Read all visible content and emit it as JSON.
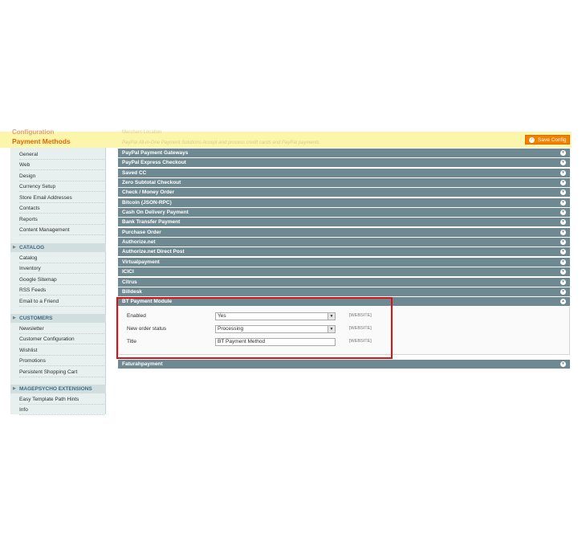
{
  "header": {
    "section_label": "Configuration",
    "page_title": "Payment Methods",
    "band_text_1": "Merchant Location",
    "band_text_2": "PayPal All-in-One Payment Solutions  Accept and process credit cards and PayPal payments",
    "save_button": "Save Config"
  },
  "sidebar": {
    "general_items": [
      "General",
      "Web",
      "Design",
      "Currency Setup",
      "Store Email Addresses",
      "Contacts",
      "Reports",
      "Content Management"
    ],
    "catalog_header": "CATALOG",
    "catalog_items": [
      "Catalog",
      "Inventory",
      "Google Sitemap",
      "RSS Feeds",
      "Email to a Friend"
    ],
    "customers_header": "CUSTOMERS",
    "customers_items": [
      "Newsletter",
      "Customer Configuration",
      "Wishlist",
      "Promotions",
      "Persistent Shopping Cart"
    ],
    "magepsycho_header": "MAGEPSYCHO EXTENSIONS",
    "magepsycho_items": [
      "Easy Template Path Hints",
      "Info"
    ]
  },
  "sections": [
    "PayPal Payment Gateways",
    "PayPal Express Checkout",
    "Saved CC",
    "Zero Subtotal Checkout",
    "Check / Money Order",
    "Bitcoin (JSON-RPC)",
    "Cash On Delivery Payment",
    "Bank Transfer Payment",
    "Purchase Order",
    "Authorize.net",
    "Authorize.net Direct Post",
    "Virtualpayment",
    "ICICI",
    "Citrus",
    "Billdesk"
  ],
  "bt_module": {
    "title": "BT Payment Module",
    "enabled_label": "Enabled",
    "enabled_value": "Yes",
    "order_status_label": "New order status",
    "order_status_value": "Processing",
    "title_label": "Title",
    "title_value": "BT Payment Method",
    "scope": "[WEBSITE]"
  },
  "last_section": "Faturahpayment"
}
